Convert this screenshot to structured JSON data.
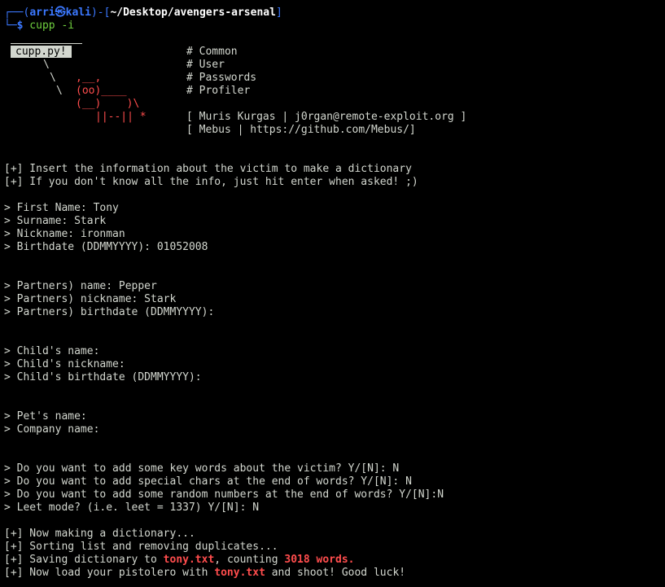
{
  "prompt": {
    "corner_top": "┌──(",
    "user": "arri",
    "at_symbol": "㉿",
    "host": "kali",
    "sep_open": ")-[",
    "path": "~/Desktop/avengers-arsenal",
    "sep_close": "]",
    "corner_bottom": "└─",
    "dollar": "$",
    "command": " cupp -i"
  },
  "logo": {
    "badge": "cupp.py!",
    "line1": "\\",
    "line2": "\\",
    "line3": "\\",
    "cow_ears": ",__,",
    "cow_eyes": "(oo)____",
    "cow_body": "(__)    )\\",
    "cow_legs": "||--|| *",
    "cow_legs_star": " *"
  },
  "info": {
    "common": "# Common",
    "user": "# User",
    "passwords": "# Passwords",
    "profiler": "# Profiler",
    "author1": "[ Muris Kurgas | j0rgan@remote-exploit.org ]",
    "author2": "[ Mebus | https://github.com/Mebus/]"
  },
  "intro": {
    "line1": "[+] Insert the information about the victim to make a dictionary",
    "line2": "[+] If you don't know all the info, just hit enter when asked! ;)"
  },
  "victim": {
    "first_name": "> First Name: Tony",
    "surname": "> Surname: Stark",
    "nickname": "> Nickname: ironman",
    "birthdate": "> Birthdate (DDMMYYYY): 01052008"
  },
  "partner": {
    "name": "> Partners) name: Pepper",
    "nickname": "> Partners) nickname: Stark",
    "birthdate": "> Partners) birthdate (DDMMYYYY):"
  },
  "child": {
    "name": "> Child's name:",
    "nickname": "> Child's nickname:",
    "birthdate": "> Child's birthdate (DDMMYYYY):"
  },
  "other": {
    "pet": "> Pet's name:",
    "company": "> Company name:"
  },
  "questions": {
    "keywords": "> Do you want to add some key words about the victim? Y/[N]: N",
    "special": "> Do you want to add special chars at the end of words? Y/[N]: N",
    "random": "> Do you want to add some random numbers at the end of words? Y/[N]:N",
    "leet": "> Leet mode? (i.e. leet = 1337) Y/[N]: N"
  },
  "results": {
    "making": "[+] Now making a dictionary...",
    "sorting": "[+] Sorting list and removing duplicates...",
    "saving_prefix": "[+] Saving dictionary to ",
    "saving_file": "tony.txt",
    "saving_mid": ", counting ",
    "saving_count": "3018 words.",
    "load_prefix": "[+] Now load your pistolero with ",
    "load_file": "tony.txt",
    "load_suffix": " and shoot! Good luck!"
  },
  "colors": {
    "background": "#000000",
    "text": "#d3d7cf",
    "prompt_frame": "#3b78ff",
    "prompt_dollar": "#3b78ff",
    "command": "#6fcf3f",
    "highlight": "#ff4d4d"
  }
}
